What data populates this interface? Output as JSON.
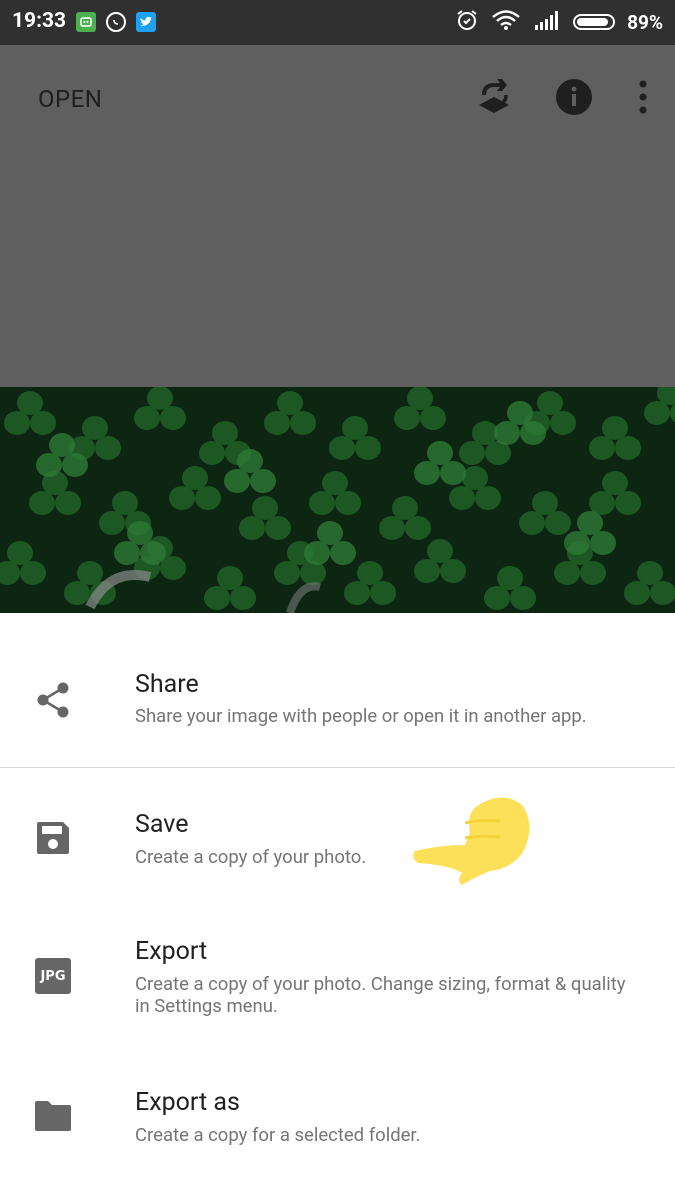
{
  "status_bar": {
    "time": "19:33",
    "battery_percent": "89%",
    "icons": [
      "app-notification-icon",
      "whatsapp-icon",
      "twitter-icon",
      "alarm-icon",
      "wifi-icon",
      "signal-icon",
      "battery-icon"
    ]
  },
  "toolbar": {
    "open_label": "OPEN",
    "icons": [
      "layers-undo-icon",
      "info-icon",
      "more-vert-icon"
    ]
  },
  "menu": {
    "items": [
      {
        "title": "Share",
        "description": "Share your image with people or open it in another app.",
        "icon": "share-icon"
      },
      {
        "title": "Save",
        "description": "Create a copy of your photo.",
        "icon": "save-icon"
      },
      {
        "title": "Export",
        "description": "Create a copy of your photo. Change sizing, format & quality in Settings menu.",
        "icon": "jpg-icon",
        "icon_text": "JPG"
      },
      {
        "title": "Export as",
        "description": "Create a copy for a selected folder.",
        "icon": "folder-icon"
      }
    ]
  },
  "colors": {
    "status_bar": "#303030",
    "dim_overlay": "#5f5f5f",
    "icon_gray": "#666666",
    "annotation_yellow": "#fde05a"
  }
}
